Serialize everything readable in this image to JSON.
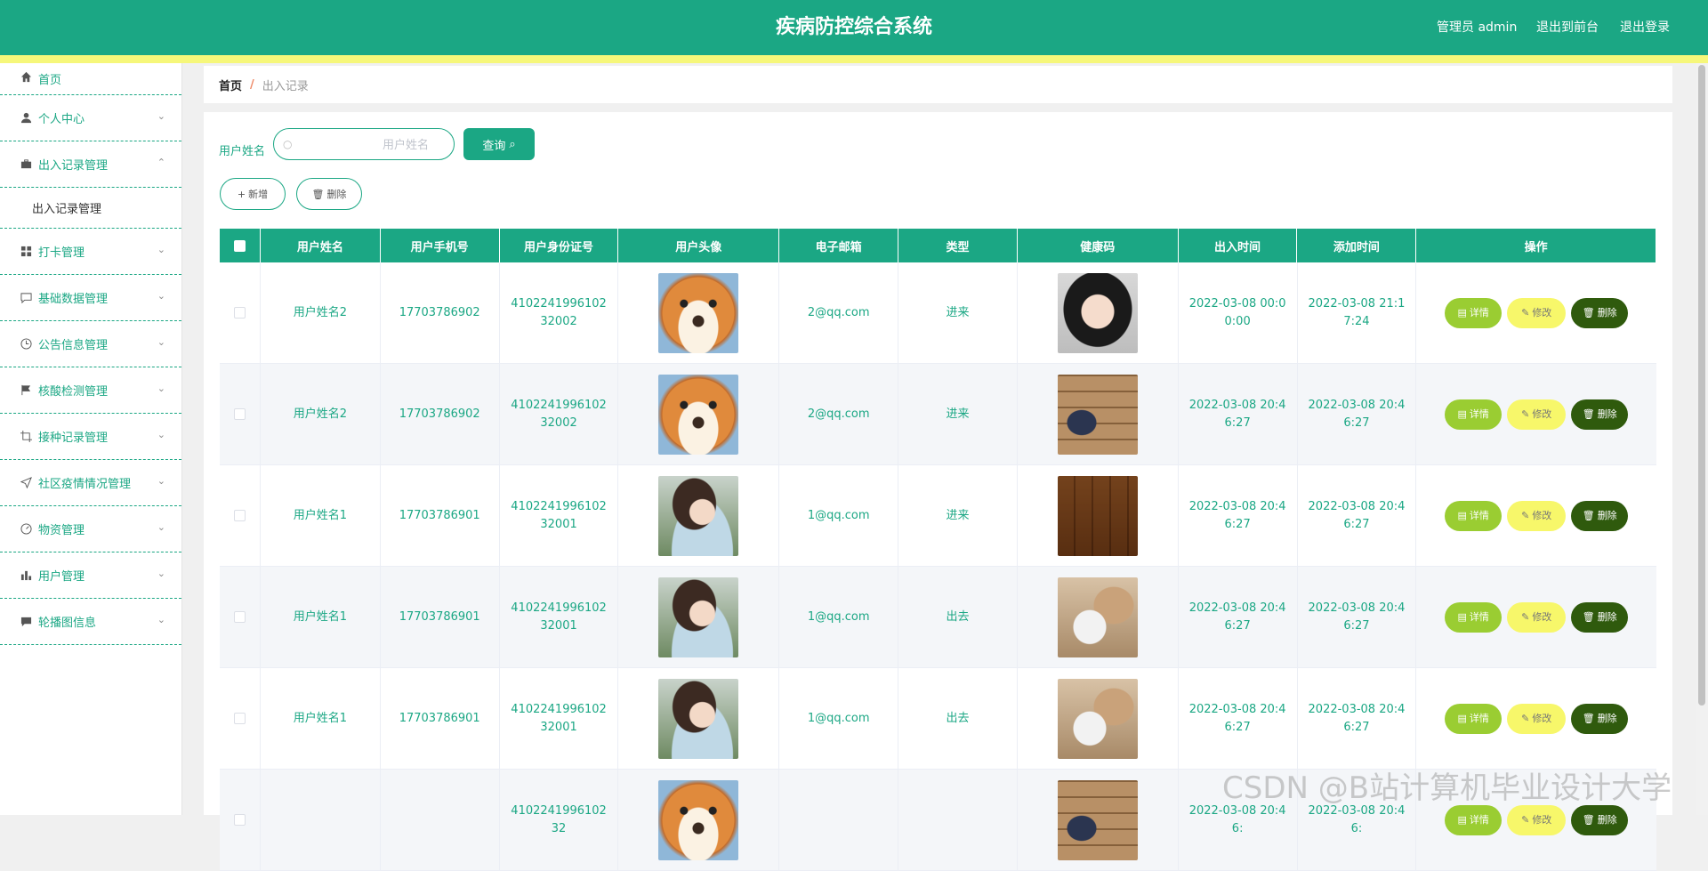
{
  "header": {
    "title": "疾病防控综合系统",
    "user": "管理员 admin",
    "to_front": "退出到前台",
    "logout": "退出登录"
  },
  "sidebar": {
    "items": [
      {
        "label": "首页",
        "icon": "home-icon"
      },
      {
        "label": "个人中心",
        "icon": "user-icon"
      },
      {
        "label": "出入记录管理",
        "icon": "briefcase-icon",
        "expanded": true,
        "sub": "出入记录管理"
      },
      {
        "label": "打卡管理",
        "icon": "grid-icon"
      },
      {
        "label": "基础数据管理",
        "icon": "chat-icon"
      },
      {
        "label": "公告信息管理",
        "icon": "clock-icon"
      },
      {
        "label": "核酸检测管理",
        "icon": "flag-icon"
      },
      {
        "label": "接种记录管理",
        "icon": "crop-icon"
      },
      {
        "label": "社区疫情情况管理",
        "icon": "send-icon"
      },
      {
        "label": "物资管理",
        "icon": "dashboard-icon"
      },
      {
        "label": "用户管理",
        "icon": "bar-chart-icon"
      },
      {
        "label": "轮播图信息",
        "icon": "message-icon"
      }
    ]
  },
  "breadcrumb": {
    "home": "首页",
    "sep": "/",
    "current": "出入记录"
  },
  "search": {
    "label": "用户姓名",
    "placeholder": "用户姓名",
    "button": "查询"
  },
  "actions": {
    "add": "新增",
    "delete": "删除"
  },
  "table": {
    "columns": [
      "用户姓名",
      "用户手机号",
      "用户身份证号",
      "用户头像",
      "电子邮箱",
      "类型",
      "健康码",
      "出入时间",
      "添加时间",
      "操作"
    ],
    "row_ops": {
      "detail": "详情",
      "edit": "修改",
      "delete": "删除"
    },
    "rows": [
      {
        "name": "用户姓名2",
        "phone": "17703786902",
        "idcard": "410224199610232002",
        "avatar": "dog",
        "email": "2@qq.com",
        "type": "进来",
        "code": "girl",
        "in_time": "2022-03-08 00:00:00",
        "add_time": "2022-03-08 21:17:24"
      },
      {
        "name": "用户姓名2",
        "phone": "17703786902",
        "idcard": "410224199610232002",
        "avatar": "dog",
        "email": "2@qq.com",
        "type": "进来",
        "code": "warehouse",
        "in_time": "2022-03-08 20:46:27",
        "add_time": "2022-03-08 20:46:27"
      },
      {
        "name": "用户姓名1",
        "phone": "17703786901",
        "idcard": "410224199610232001",
        "avatar": "girl",
        "email": "1@qq.com",
        "type": "进来",
        "code": "boxes",
        "in_time": "2022-03-08 20:46:27",
        "add_time": "2022-03-08 20:46:27"
      },
      {
        "name": "用户姓名1",
        "phone": "17703786901",
        "idcard": "410224199610232001",
        "avatar": "girl",
        "email": "1@qq.com",
        "type": "出去",
        "code": "suit",
        "in_time": "2022-03-08 20:46:27",
        "add_time": "2022-03-08 20:46:27"
      },
      {
        "name": "用户姓名1",
        "phone": "17703786901",
        "idcard": "410224199610232001",
        "avatar": "girl",
        "email": "1@qq.com",
        "type": "出去",
        "code": "suit",
        "in_time": "2022-03-08 20:46:27",
        "add_time": "2022-03-08 20:46:27"
      },
      {
        "name": "",
        "phone": "",
        "idcard": "410224199610232",
        "avatar": "dog",
        "email": "",
        "type": "",
        "code": "warehouse",
        "in_time": "2022-03-08 20:46:",
        "add_time": "2022-03-08 20:46:"
      }
    ]
  },
  "watermark": "CSDN @B站计算机毕业设计大学"
}
